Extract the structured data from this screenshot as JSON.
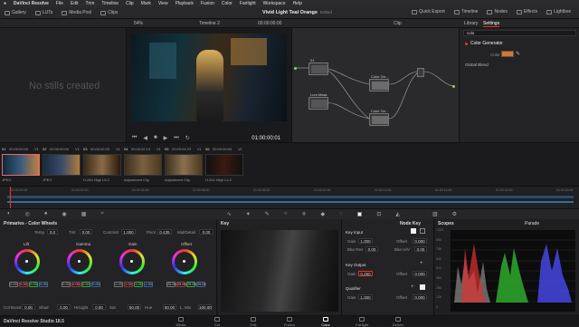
{
  "menubar": {
    "apple": "",
    "app": "DaVinci Resolve",
    "items": [
      "File",
      "Edit",
      "Trim",
      "Timeline",
      "Clip",
      "Mark",
      "View",
      "Playback",
      "Fusion",
      "Color",
      "Fairlight",
      "Workspace",
      "Help"
    ]
  },
  "toolbar": {
    "left": [
      "Gallery",
      "LUTs",
      "Media Pool",
      "Clips"
    ],
    "title": "Vivid Light Teal Orange",
    "edited": "Edited",
    "right": [
      "Quick Export",
      "Timeline",
      "Nodes",
      "Effects",
      "Lightbox"
    ]
  },
  "viewerbar": {
    "zoom": "54%",
    "timeline": "Timeline 2",
    "timecode": "00:00:00:00",
    "mode": "Clip",
    "panel_tabs": [
      "Library",
      "Settings"
    ]
  },
  "gallery": {
    "empty": "No stills created"
  },
  "viewer": {
    "timecode": "01:00:00:01"
  },
  "nodes": {
    "items": [
      {
        "label": "01",
        "name": ""
      },
      {
        "label": "Color Ge...",
        "name": "03"
      },
      {
        "label": "Lum Mask",
        "name": "02"
      },
      {
        "label": "Color Ge...",
        "name": "04"
      }
    ]
  },
  "rpanel": {
    "search": "colo",
    "section": "Color Generator",
    "color_label": "Color",
    "color_value": "#d9762e",
    "global_blend": "Global Blend"
  },
  "clips": {
    "items": [
      {
        "num": "01",
        "tc": "00:00:00:00",
        "track": "V1",
        "name": "JPEG"
      },
      {
        "num": "02",
        "tc": "00:00:00:00",
        "track": "V1",
        "name": "JPEG"
      },
      {
        "num": "03",
        "tc": "00:00:02:05",
        "track": "V1",
        "name": "H.264 High L5.2"
      },
      {
        "num": "04",
        "tc": "00:00:02:13",
        "track": "V1",
        "name": "Adjustment Clip"
      },
      {
        "num": "05",
        "tc": "00:00:04:23",
        "track": "V1",
        "name": "Adjustment Clip"
      },
      {
        "num": "06",
        "tc": "00:00:00:00",
        "track": "V1",
        "name": "H.264 High L4.2"
      }
    ]
  },
  "timeline": {
    "ticks": [
      "01:00:00:00",
      "01:00:02:00",
      "01:00:04:00",
      "01:00:06:00",
      "01:00:08:00",
      "01:00:10:00",
      "01:00:12:00",
      "01:00:14:00",
      "01:00:16:00",
      "01:00:18:00"
    ]
  },
  "primaries": {
    "title": "Primaries - Color Wheels",
    "temp_label": "Temp",
    "temp": "0.0",
    "tint_label": "Tint",
    "tint": "0.00",
    "contrast_label": "Contrast",
    "contrast": "1.000",
    "pivot_label": "Pivot",
    "pivot": "0.435",
    "middetail_label": "Mid/Detail",
    "middetail": "0.00",
    "wheels": [
      {
        "name": "Lift",
        "values": [
          "0.00",
          "0.00",
          "0.00",
          "0.00"
        ]
      },
      {
        "name": "Gamma",
        "values": [
          "0.00",
          "0.00",
          "0.00",
          "0.00"
        ]
      },
      {
        "name": "Gain",
        "values": [
          "1.00",
          "1.00",
          "1.00",
          "1.00"
        ]
      },
      {
        "name": "Offset",
        "values": [
          "25.00",
          "25.00",
          "25.00",
          "25.00"
        ]
      }
    ],
    "bottom": [
      {
        "label": "Col Boost",
        "value": "0.00"
      },
      {
        "label": "Shad",
        "value": "0.00"
      },
      {
        "label": "Hi/Light",
        "value": "0.00"
      },
      {
        "label": "Sat",
        "value": "50.00"
      },
      {
        "label": "Hue",
        "value": "50.00"
      },
      {
        "label": "L. Mix",
        "value": "100.00"
      }
    ]
  },
  "key": {
    "title": "Key"
  },
  "keyparams": {
    "title": "Node Key",
    "key_input": "Key Input",
    "key_output": "Key Output",
    "qualifier": "Qualifier",
    "gain_label": "Gain",
    "offset_label": "Offset",
    "blur_label": "Blur Res",
    "blur_h_label": "Blur H/V",
    "in_gain": "1.000",
    "in_offset": "0.000",
    "in_blur": "0.00",
    "in_blurhv": "0.00",
    "out_gain": "0.250",
    "out_offset": "0.000",
    "q_gain": "1.000",
    "q_offset": "0.000"
  },
  "scopes": {
    "title": "Scopes",
    "mode": "Parade",
    "axis": [
      "1023",
      "896",
      "768",
      "640",
      "512",
      "384",
      "256",
      "128",
      "0"
    ]
  },
  "pagebar": {
    "product": "DaVinci Resolve Studio 18.5",
    "pages": [
      "Media",
      "Cut",
      "Edit",
      "Fusion",
      "Color",
      "Fairlight",
      "Deliver"
    ],
    "active": "Color"
  }
}
